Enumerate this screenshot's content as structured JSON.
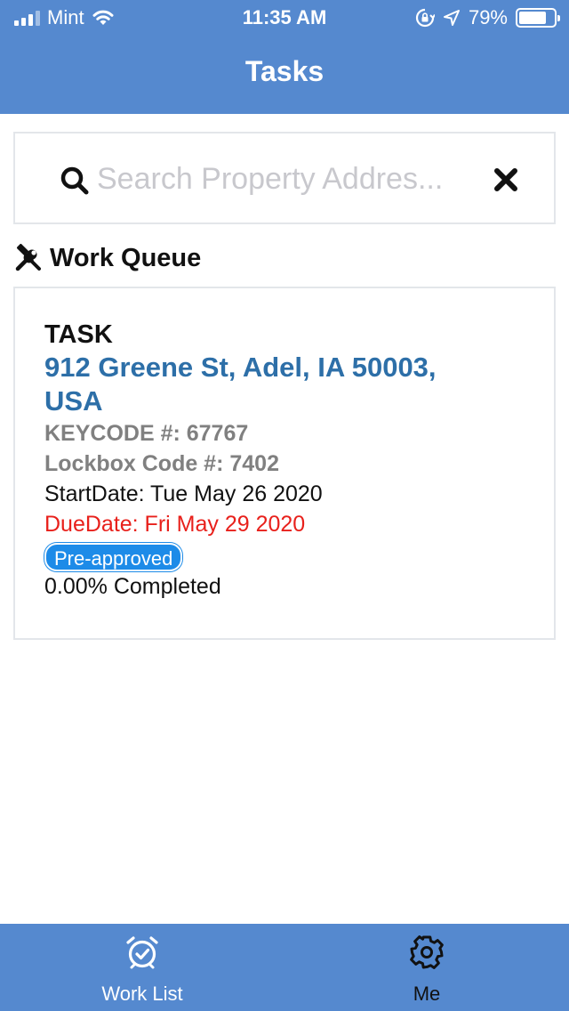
{
  "theme": {
    "primary": "#5589cf",
    "address_color": "#2d6fa8",
    "due_color": "#e8201b",
    "badge_color": "#1d8be8"
  },
  "status_bar": {
    "carrier": "Mint",
    "time": "11:35 AM",
    "battery_percent": "79%",
    "battery_level": 0.79,
    "icons": [
      "signal-icon",
      "wifi-icon",
      "rotation-lock-icon",
      "location-icon",
      "battery-icon"
    ]
  },
  "nav": {
    "title": "Tasks"
  },
  "search": {
    "placeholder": "Search Property Addres...",
    "value": "",
    "icon": "search-icon",
    "clear_icon": "close-icon"
  },
  "section": {
    "title": "Work Queue",
    "icon": "tools-icon"
  },
  "tasks": [
    {
      "type": "TASK",
      "address": "912 Greene St, Adel, IA 50003, USA",
      "keycode": "KEYCODE #: 67767",
      "lockbox": "Lockbox Code #: 7402",
      "start_date": "StartDate: Tue May 26 2020",
      "due_date": "DueDate: Fri May 29 2020",
      "badge": "Pre-approved",
      "progress": "0.00% Completed",
      "progress_value": 0.0
    }
  ],
  "tab_bar": {
    "tabs": [
      {
        "label": "Work List",
        "icon": "alarm-clock-check-icon",
        "active": true
      },
      {
        "label": "Me",
        "icon": "gear-icon",
        "active": false
      }
    ]
  }
}
